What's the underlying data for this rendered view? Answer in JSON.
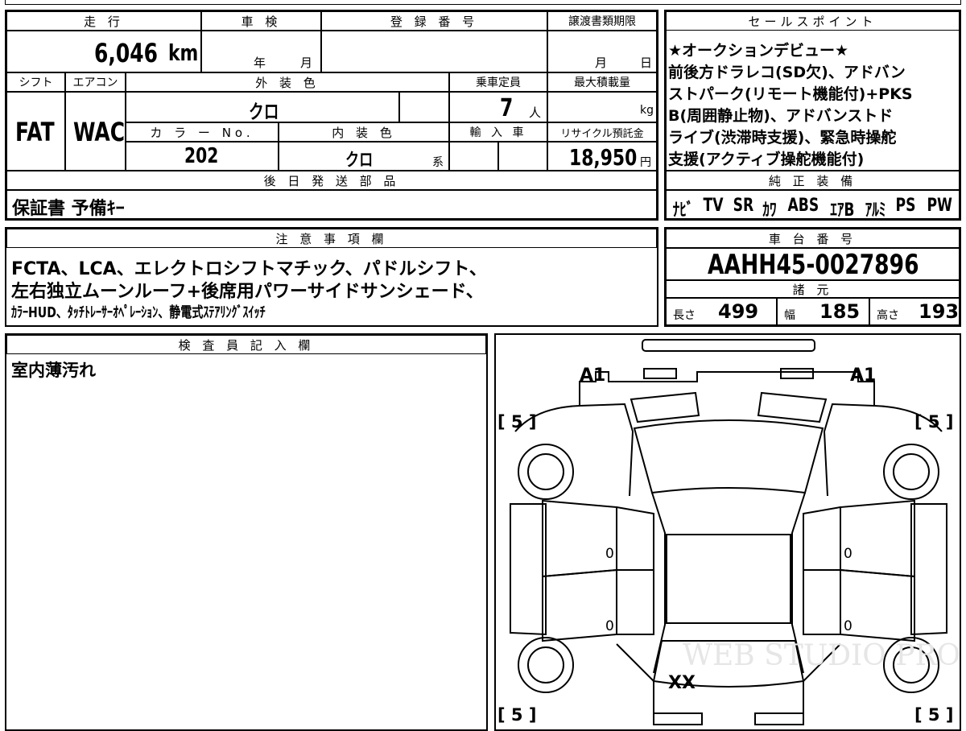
{
  "main": {
    "mileage_header": "走 行",
    "mileage_value": "6,046",
    "mileage_unit": "km",
    "shaken_header": "車 検",
    "shaken_year": "年",
    "shaken_month": "月",
    "reg_header": "登 録 番 号",
    "transfer_header": "譲渡書類期限",
    "transfer_month": "月",
    "transfer_day": "日",
    "shift_header": "シフト",
    "shift_value": "FAT",
    "ac_header": "エアコン",
    "ac_value": "WAC",
    "exterior_header": "外 装 色",
    "exterior_value": "クロ",
    "capacity_header": "乗車定員",
    "capacity_value": "7",
    "capacity_unit": "人",
    "maxload_header": "最大積載量",
    "maxload_unit": "kg",
    "colorno_header": "カ ラ ー No.",
    "colorno_value": "202",
    "interior_header": "内 装 色",
    "interior_value": "クロ",
    "interior_unit": "系",
    "import_header": "輸 入 車",
    "recycle_header": "リサイクル預託金",
    "recycle_value": "18,950",
    "recycle_unit": "円",
    "later_parts_header": "後 日 発 送 部 品",
    "later_parts_value": "保証書 予備ｷｰ"
  },
  "sales": {
    "header": "セールスポイント",
    "lines": [
      "★オークションデビュー★",
      "前後方ドラレコ(SD欠)、アドバン",
      "ストパーク(リモート機能付)+PKS",
      "B(周囲静止物)、アドバンストド",
      "ライブ(渋滞時支援)、緊急時操舵",
      "支援(アクティブ操舵機能付)"
    ]
  },
  "equipment": {
    "header": "純 正 装 備",
    "items": [
      "ﾅﾋﾞ",
      "TV",
      "SR",
      "ｶﾜ",
      "ABS",
      "ｴｱB",
      "ｱﾙﾐ",
      "PS",
      "PW"
    ]
  },
  "notes": {
    "header": "注 意 事 項 欄",
    "lines": [
      "FCTA、LCA、エレクトロシフトマチック、パドルシフト、",
      "左右独立ムーンルーフ+後席用パワーサイドサンシェード、",
      "ｶﾗｰHUD、ﾀｯﾁﾄﾚｰｻｰｵﾍﾟﾚｰｼｮﾝ、静電式ｽﾃｱﾘﾝｸﾞｽｲｯﾁ"
    ]
  },
  "chassis": {
    "header": "車 台 番 号",
    "value": "AAHH45-0027896"
  },
  "specs": {
    "header": "諸 元",
    "length_label": "長さ",
    "length_value": "499",
    "width_label": "幅",
    "width_value": "185",
    "height_label": "高さ",
    "height_value": "193"
  },
  "inspector": {
    "header": "検 査 員 記 入 欄",
    "text": "室内薄汚れ"
  },
  "diagram": {
    "mark_a1_left": "A1",
    "mark_a1_right": "A1",
    "tire_fl": "[ 5 ]",
    "tire_fr": "[ 5 ]",
    "tire_rl": "[ 5 ]",
    "tire_rr": "[ 5 ]",
    "door_fl": "0",
    "door_fr": "0",
    "door_rl": "0",
    "door_rr": "0",
    "rear_mark": "XX",
    "watermark": "WEB STUDIO PRO"
  },
  "colors": {
    "line": "#000000",
    "background": "#ffffff",
    "watermark": "#e6e6e6"
  }
}
